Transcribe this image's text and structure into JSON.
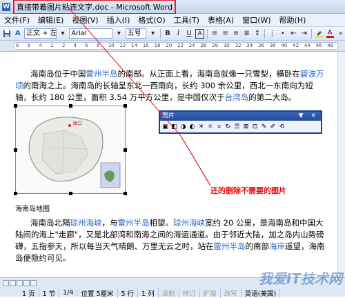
{
  "window": {
    "app_icon": "W",
    "title": "直接带着图片粘连文字.doc - Microsoft Word"
  },
  "menu": {
    "items": [
      "文件(F)",
      "编辑(E)",
      "视图(V)",
      "插入(I)",
      "格式(O)",
      "工具(T)",
      "表格(A)",
      "窗口(W)",
      "帮助(H)"
    ]
  },
  "toolbar": {
    "style_value": "正文 + 左",
    "font_value": "Arial",
    "size_value": "五号",
    "bold": "B",
    "italic": "I",
    "underline": "U",
    "char_scale": "A",
    "font_color": "A"
  },
  "ruler": {
    "ticks": [
      "8",
      "6",
      "4",
      "2",
      "2",
      "4",
      "6",
      "8",
      "10",
      "12",
      "14",
      "16",
      "18",
      "20",
      "22",
      "24",
      "26",
      "28",
      "30",
      "32",
      "34",
      "36",
      "38",
      "40",
      "42",
      "44",
      "46",
      "48"
    ]
  },
  "document": {
    "para1": {
      "t1": "海南岛位于中国",
      "l1": "雷州半岛",
      "t2": "的南部。从正面上看，海南岛就像一只雪梨，横卧在",
      "l2": "碧波万顷",
      "t3": "的南海之上。海南岛的长轴呈东北一西南向，长约 300 余公里，西北一东南向为短轴，长约 180 公里，面积 3.54 万平方公里，是中国仅次于",
      "l3": "台湾岛",
      "t4": "的第二大岛。"
    },
    "map_label": "海口",
    "caption": "海南岛地图",
    "para2": {
      "t1": "海南岛北隔",
      "l1": "琼州海峡",
      "t2": "，与",
      "l2": "雷州半岛",
      "t3": "相望。",
      "l3": "琼州海峡",
      "t4": "宽约 20 公里，是海南岛和中国大陆间的海上\"走廊\"，又是北部湾和南海之间的海运通道。由于邻近大陆，加之岛内山势磅礴，五指参天，所以每当天气晴朗、万里无云之时，站在",
      "l4": "雷州半岛",
      "t5": "的南部",
      "l5": "海岸",
      "t6": "遥望，海南岛便隐约可见。"
    }
  },
  "picture_toolbar": {
    "title": "图片",
    "title_buttons": "▼ ✕"
  },
  "annotation": "还的删除不需要的图片",
  "status": {
    "page": "1 页",
    "section": "1 节",
    "pages": "1/4",
    "position": "位置 5厘米",
    "line": "5 行",
    "column": "1 列",
    "rec": "录制",
    "trk": "修订",
    "ext": "扩展",
    "ovr": "改写",
    "lang": "英语(美国)"
  },
  "watermark": "我爱IT技术网",
  "colors": {
    "highlight": "#f7e53a",
    "font_color": "#e01010",
    "annotation": "#e01010"
  }
}
